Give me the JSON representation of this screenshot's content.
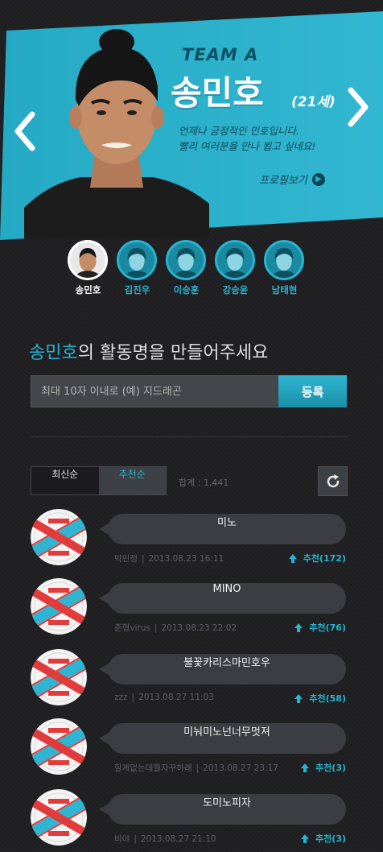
{
  "banner": {
    "team": "TEAM A",
    "name": "송민호",
    "age": "(21세)",
    "desc_line1": "언제나 긍정적인 민호입니다.",
    "desc_line2": "빨리 여러분을 만나 뵙고 싶네요!",
    "profile_link": "프로필보기",
    "accent_color": "#27b3cf"
  },
  "members": [
    {
      "name": "송민호",
      "active": true
    },
    {
      "name": "김진우",
      "active": false
    },
    {
      "name": "이승훈",
      "active": false
    },
    {
      "name": "강승윤",
      "active": false
    },
    {
      "name": "남태현",
      "active": false
    }
  ],
  "heading": {
    "highlight": "송민호",
    "rest": "의 활동명을 만들어주세요"
  },
  "form": {
    "placeholder": "최대 10자 이내로 (예) 지드래곤",
    "register_label": "등록"
  },
  "sort": {
    "latest": "최신순",
    "recommended": "추천순",
    "total": "합계 : 1,441"
  },
  "comments": [
    {
      "text": "미노",
      "user": "박민정",
      "date": "2013.08.23 16:11",
      "vote": "추천(172)"
    },
    {
      "text": "MINO",
      "user": "준형virus",
      "date": "2013.08.23 22:02",
      "vote": "추천(76)"
    },
    {
      "text": "불꽃카리스마민호우",
      "user": "zzz",
      "date": "2013.08.27 11:03",
      "vote": "추천(58)"
    },
    {
      "text": "미눠미노넌너무멋져",
      "user": "할게없는데뭘자꾸하래",
      "date": "2013.08.27 23:17",
      "vote": "추천(3)"
    },
    {
      "text": "도미노피자",
      "user": "비야",
      "date": "2013.08.27 21:10",
      "vote": "추천(3)"
    }
  ]
}
